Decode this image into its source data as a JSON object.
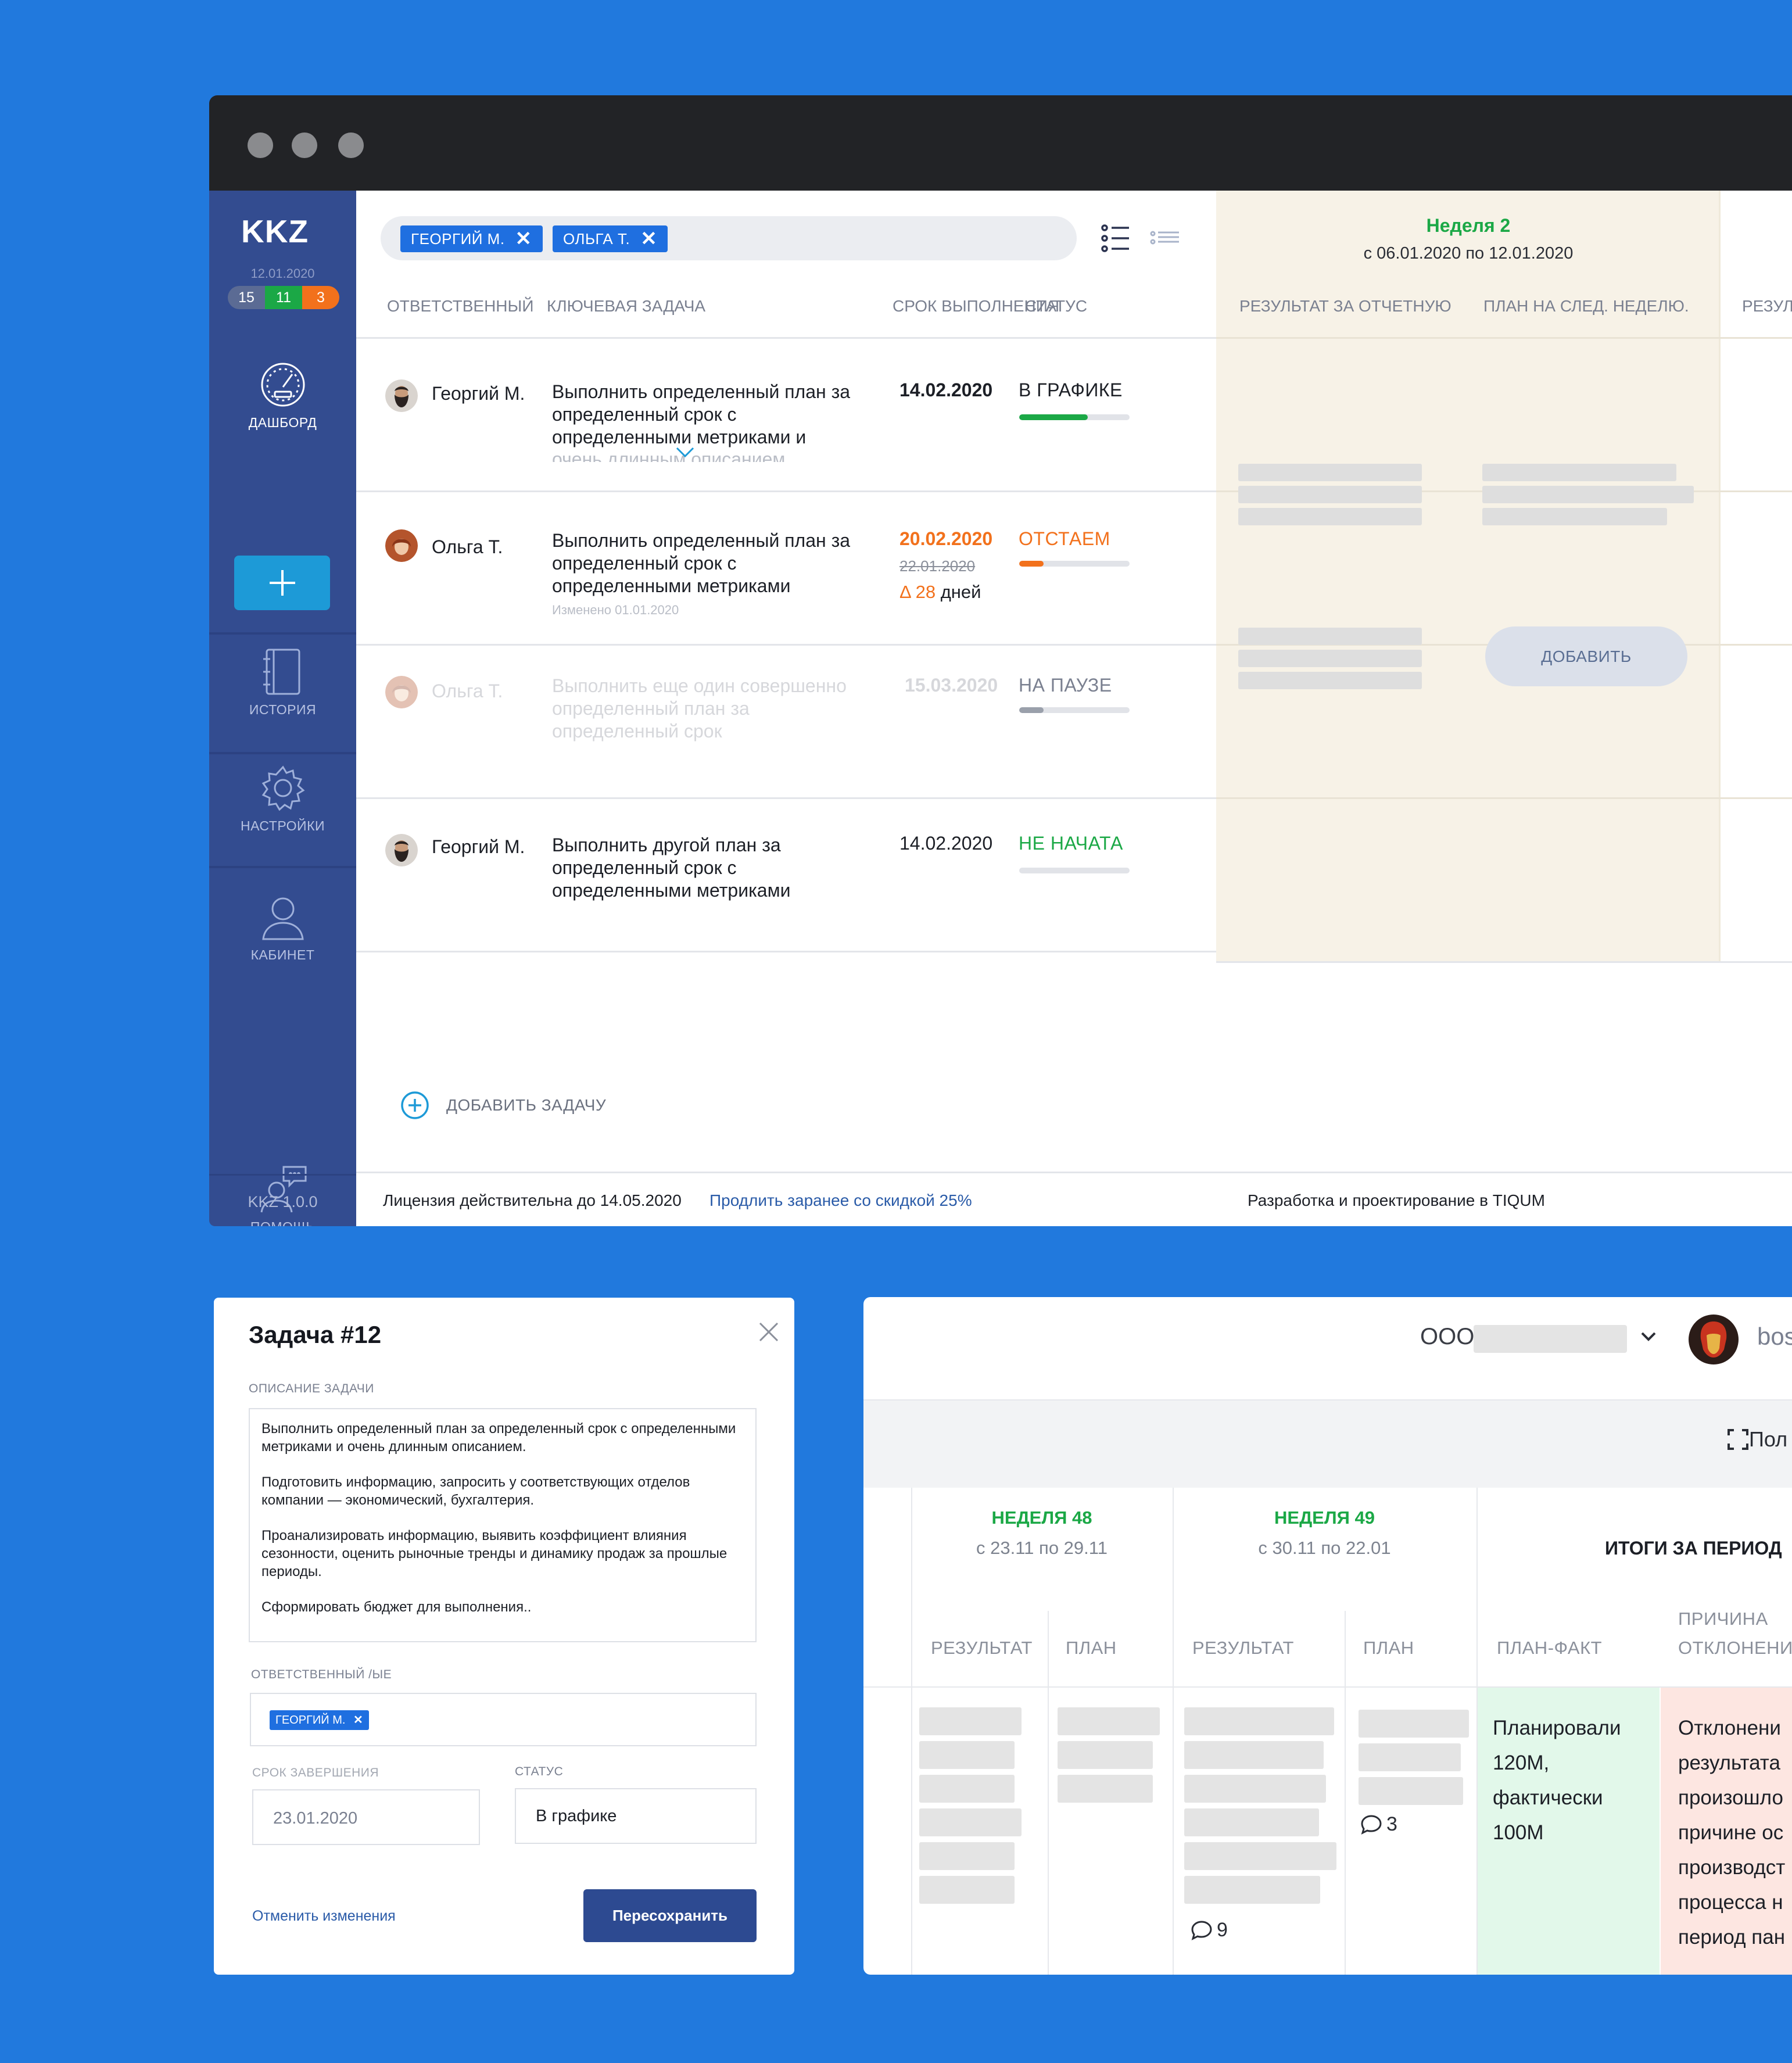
{
  "app": {
    "logo": "KKZ",
    "date": "12.01.2020",
    "counters": [
      "15",
      "11",
      "3"
    ],
    "nav": [
      {
        "label": "ДАШБОРД",
        "icon": "dashboard-icon"
      },
      {
        "label": "ИСТОРИЯ",
        "icon": "notebook-icon"
      },
      {
        "label": "НАСТРОЙКИ",
        "icon": "gear-icon"
      },
      {
        "label": "КАБИНЕТ",
        "icon": "user-icon"
      },
      {
        "label": "ПОМОЩЬ",
        "icon": "help-chat-icon"
      }
    ],
    "version": "KKZ 1.0.0"
  },
  "filters": {
    "chips": [
      "ГЕОРГИЙ М.",
      "ОЛЬГА Т."
    ]
  },
  "table": {
    "headers": {
      "responsible": "ОТВЕТСТВЕННЫЙ",
      "task": "КЛЮЧЕВАЯ ЗАДАЧА",
      "deadline": "СРОК ВЫПОЛНЕНИЯ",
      "status": "СТАТУС"
    },
    "rows": [
      {
        "name": "Георгий М.",
        "task": "Выполнить определенный план за определенный срок с определенными метриками и",
        "task_hint": "очень длинным описанием",
        "date": "14.02.2020",
        "status": "В ГРАФИКЕ",
        "status_color": "#1c1f26",
        "progress": 0.62,
        "bar_color": "#1ba846"
      },
      {
        "name": "Ольга Т.",
        "task": "Выполнить определенный план за определенный срок с определенными метриками",
        "task_note": "Изменено 01.01.2020",
        "date": "20.02.2020",
        "date_old": "22.01.2020",
        "delta_value": "Δ 28",
        "delta_unit": "дней",
        "status": "ОТСТАЕМ",
        "status_color": "#f2711c",
        "progress": 0.22,
        "bar_color": "#f2711c"
      },
      {
        "name": "Ольга Т.",
        "task": "Выполнить еще один совершенно определенный план за определенный срок",
        "date": "15.03.2020",
        "status": "НА ПАУЗЕ",
        "status_color": "#7a8090",
        "progress": 0.22,
        "bar_color": "#9aa0ab"
      },
      {
        "name": "Георгий М.",
        "task": "Выполнить другой план за определенный срок с определенными метриками",
        "date": "14.02.2020",
        "status": "НЕ НАЧАТА",
        "status_color": "#1ba846",
        "progress": 0,
        "bar_color": "#1ba846"
      }
    ],
    "add_task": "ДОБАВИТЬ ЗАДАЧУ"
  },
  "week": {
    "title": "Неделя 2",
    "range": "с 06.01.2020 по 12.01.2020",
    "col_result": "РЕЗУЛЬТАТ ЗА ОТЧЕТНУЮ",
    "col_plan": "ПЛАН НА СЛЕД. НЕДЕЛЮ.",
    "col_next": "РЕЗУЛ",
    "add_button": "ДОБАВИТЬ"
  },
  "footer": {
    "license": "Лицензия действительна до 14.05.2020",
    "renew_link": "Продлить заранее со скидкой 25%",
    "credit": "Разработка и проектирование в TIQUM"
  },
  "dialog": {
    "title": "Задача #12",
    "desc_label": "ОПИСАНИЕ ЗАДАЧИ",
    "desc_paragraphs": [
      "Выполнить определенный план за определенный срок с определенными метриками и очень длинным описанием.",
      "Подготовить информацию, запросить у соответствующих отделов компании — экономический, бухгалтерия.",
      "Проанализировать информацию, выявить коэффициент влияния сезонности, оценить рыночные тренды и динамику продаж за прошлые периоды.",
      "Сформировать бюджет для выполнения.."
    ],
    "resp_label": "ОТВЕТСТВЕННЫЙ /ЫЕ",
    "resp_chip": "ГЕОРГИЙ М.",
    "deadline_label": "СРОК ЗАВЕРШЕНИЯ",
    "deadline_value": "23.01.2020",
    "status_label": "СТАТУС",
    "status_value": "В графике",
    "cancel": "Отменить изменения",
    "save": "Пересохранить"
  },
  "period": {
    "company_prefix": "ООО",
    "user_fragment": "bos",
    "fullscreen": "Пол",
    "week48_title": "НЕДЕЛЯ 48",
    "week48_range": "с 23.11 по 29.11",
    "week49_title": "НЕДЕЛЯ 49",
    "week49_range": "с 30.11 по 22.01",
    "totals": "ИТОГИ ЗА ПЕРИОД",
    "col_result": "РЕЗУЛЬТАТ",
    "col_plan": "ПЛАН",
    "col_planfact": "ПЛАН-ФАКТ",
    "col_reason_1": "ПРИЧИНА",
    "col_reason_2": "ОТКЛОНЕНИЯ",
    "comments_a": "9",
    "comments_b": "3",
    "planfact_lines": [
      "Планировали",
      "120М,",
      "фактически",
      "100М"
    ],
    "reason_lines": [
      "Отклонени",
      "результата",
      "произошло",
      "причине ос",
      "производст",
      "процесса н",
      "период пан"
    ]
  }
}
